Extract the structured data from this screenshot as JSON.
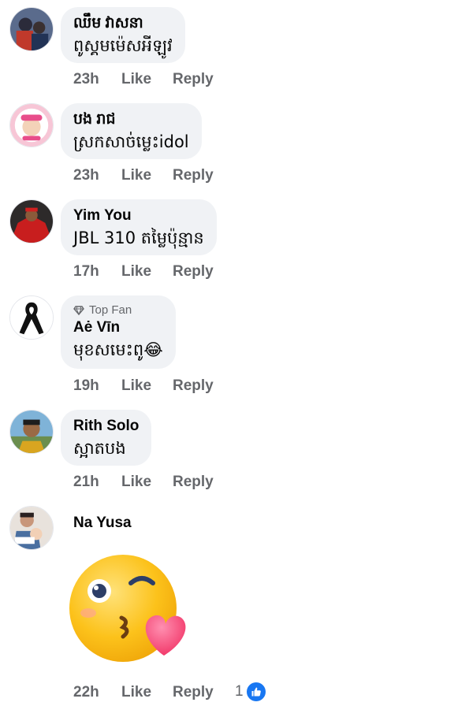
{
  "comments": [
    {
      "author": "ឈឹម វាសនា",
      "text": "ពូស្គមម៉េសអីឡូវ",
      "time": "23h",
      "like": "Like",
      "reply": "Reply"
    },
    {
      "author": "បង រាជ",
      "text": "ស្រកសាច់ម្លេះidol",
      "time": "23h",
      "like": "Like",
      "reply": "Reply"
    },
    {
      "author": "Yim You",
      "text": "JBL 310 តម្លៃប៉ុន្មាន",
      "time": "17h",
      "like": "Like",
      "reply": "Reply"
    },
    {
      "badge": "Top Fan",
      "author": "Aė Vīn",
      "text": "មុខសមេះពូ😂",
      "time": "19h",
      "like": "Like",
      "reply": "Reply"
    },
    {
      "author": "Rith Solo",
      "text": "ស្អាតបង",
      "time": "21h",
      "like": "Like",
      "reply": "Reply"
    },
    {
      "author": "Na Yusa",
      "time": "22h",
      "like": "Like",
      "reply": "Reply",
      "reaction_count": "1",
      "reaction_icon": "thumbs-up-icon"
    }
  ],
  "colors": {
    "bubble": "#f0f2f5",
    "meta": "#65676b",
    "like_blue": "#1877f2"
  }
}
